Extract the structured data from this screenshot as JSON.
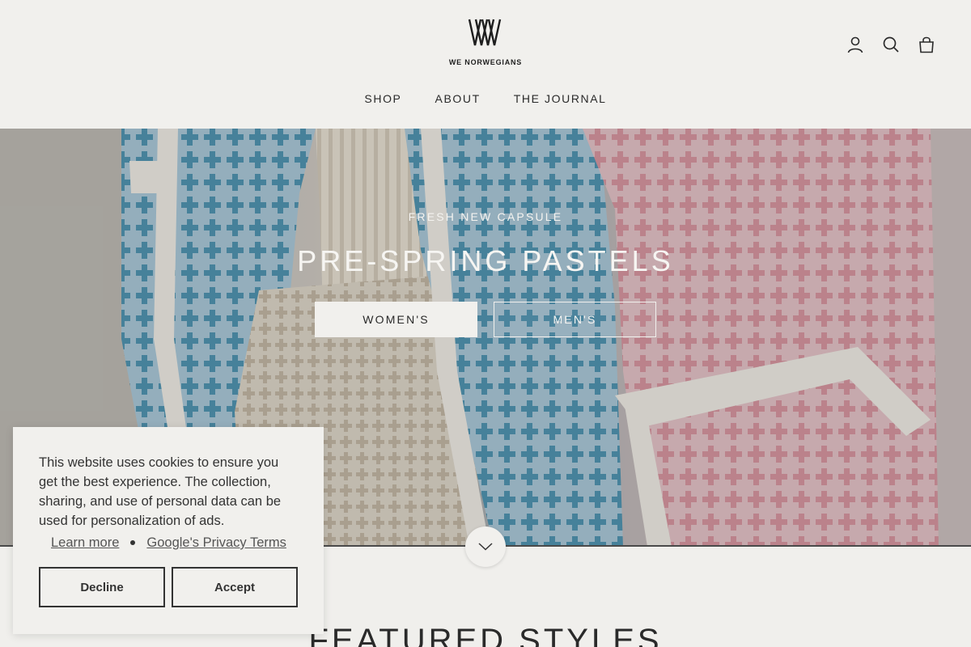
{
  "header": {
    "logo_text": "WE NORWEGIANS",
    "nav": [
      "SHOP",
      "ABOUT",
      "THE JOURNAL"
    ],
    "icons": [
      "account-icon",
      "search-icon",
      "cart-icon"
    ]
  },
  "hero": {
    "eyebrow": "FRESH NEW CAPSULE",
    "title": "PRE-SPRING PASTELS",
    "buttons": [
      "WOMEN'S",
      "MEN'S"
    ],
    "scroll_icon": "chevron-down-icon"
  },
  "featured": {
    "title": "FEATURED STYLES"
  },
  "cookie": {
    "text": "This website uses cookies to ensure you get the best experience. The collection, sharing, and use of personal data can be used for personalization of ads.",
    "links": [
      "Learn more",
      "Google's Privacy Terms"
    ],
    "decline_label": "Decline",
    "accept_label": "Accept"
  },
  "colors": {
    "background": "#f1f0ed",
    "text": "#2a2a2a",
    "blue_knit": "#4f93b0",
    "pink_knit": "#d99aa7"
  }
}
